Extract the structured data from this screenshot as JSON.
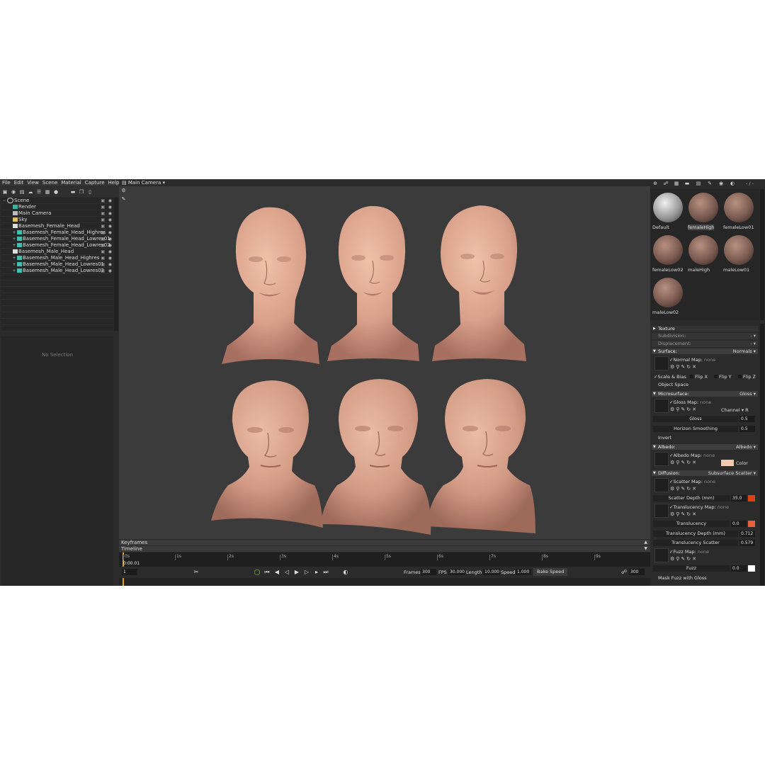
{
  "menu": [
    "File",
    "Edit",
    "View",
    "Scene",
    "Material",
    "Capture",
    "Help"
  ],
  "scene_toolbar_icons": [
    "cube-icon",
    "light-icon",
    "camera-icon",
    "sky-icon",
    "layers-icon",
    "box-icon",
    "sphere-icon",
    "folder-icon",
    "duplicate-icon",
    "trash-icon"
  ],
  "scene_tree": [
    {
      "label": "Scene",
      "indent": 0,
      "icon": "scene"
    },
    {
      "label": "Render",
      "indent": 1,
      "icon": "render"
    },
    {
      "label": "Main Camera",
      "indent": 1,
      "icon": "camera"
    },
    {
      "label": "Sky",
      "indent": 1,
      "icon": "sky"
    },
    {
      "label": "Basemesh_Female_Head",
      "indent": 1,
      "icon": "group"
    },
    {
      "label": "Basemesh_Female_Head_Highres",
      "indent": 2,
      "icon": "mesh"
    },
    {
      "label": "Basemesh_Female_Head_Lowres01",
      "indent": 2,
      "icon": "mesh"
    },
    {
      "label": "Basemesh_Female_Head_Lowres02",
      "indent": 2,
      "icon": "mesh"
    },
    {
      "label": "Basemesh_Male_Head",
      "indent": 1,
      "icon": "group"
    },
    {
      "label": "Basemesh_Male_Head_Highres",
      "indent": 2,
      "icon": "mesh"
    },
    {
      "label": "Basemesh_Male_Head_Lowres01",
      "indent": 2,
      "icon": "mesh"
    },
    {
      "label": "Basemesh_Male_Head_Lowres02",
      "indent": 2,
      "icon": "mesh"
    }
  ],
  "no_selection": "No Selection",
  "viewport": {
    "camera": "Main Camera"
  },
  "timeline": {
    "keyframes_label": "Keyframes",
    "timeline_label": "Timeline",
    "ticks": [
      "0s",
      "1s",
      "2s",
      "3s",
      "4s",
      "5s",
      "6s",
      "7s",
      "8s",
      "9s"
    ],
    "current_time": "0:00.01",
    "frame_field": "1",
    "frames_label": "Frames",
    "frames": "300",
    "fps_label": "FPS",
    "fps": "30.000",
    "length_label": "Length",
    "length": "10.000",
    "speed_label": "Speed",
    "speed": "1.000",
    "bake_label": "Bake Speed",
    "end_frame": "300"
  },
  "materials": {
    "toolbar_right": "- / -",
    "items": [
      {
        "name": "Default",
        "color": "#c8c8c8",
        "selected": false
      },
      {
        "name": "femaleHigh",
        "color": "#8a6a5e",
        "selected": true
      },
      {
        "name": "femaleLow01",
        "color": "#8c6c60",
        "selected": false
      },
      {
        "name": "femaleLow02",
        "color": "#8b6b5f",
        "selected": false
      },
      {
        "name": "maleHigh",
        "color": "#8a6a5e",
        "selected": false
      },
      {
        "name": "maleLow01",
        "color": "#8c6c60",
        "selected": false
      },
      {
        "name": "maleLow02",
        "color": "#8b6b5f",
        "selected": false
      }
    ]
  },
  "props": {
    "texture": "Texture",
    "subdivision": "Subdivision:",
    "displacement": "Displacement:",
    "surface": {
      "label": "Surface:",
      "mode": "Normals",
      "map_label": "Normal Map:",
      "map_value": "none",
      "scale_bias": "Scale & Bias",
      "flip_x": "Flip X",
      "flip_y": "Flip Y",
      "flip_z": "Flip Z",
      "object_space": "Object Space"
    },
    "microsurface": {
      "label": "Microsurface:",
      "mode": "Gloss",
      "map_label": "Gloss Map:",
      "map_value": "none",
      "channel": "Channel",
      "channel_value": "R",
      "gloss_label": "Gloss",
      "gloss": "0.5",
      "horizon_label": "Horizon Smoothing",
      "horizon": "0.5",
      "invert": "Invert"
    },
    "albedo": {
      "label": "Albedo:",
      "mode": "Albedo",
      "map_label": "Albedo Map:",
      "map_value": "none",
      "color_label": "Color",
      "color": "#f5c8b0"
    },
    "diffusion": {
      "label": "Diffusion:",
      "mode": "Subsurface Scatter",
      "scatter_map_label": "Scatter Map:",
      "scatter_map_value": "none",
      "scatter_depth_label": "Scatter Depth (mm)",
      "scatter_depth": "35.0",
      "scatter_color": "#e04010",
      "translucency_map_label": "Translucency Map:",
      "translucency_map_value": "none",
      "translucency_label": "Translucency",
      "translucency": "0.0",
      "translucency_color": "#e86040",
      "trans_depth_label": "Translucency Depth (mm)",
      "trans_depth": "0.712",
      "trans_scatter_label": "Translucency Scatter",
      "trans_scatter": "0.579",
      "fuzz_map_label": "Fuzz Map:",
      "fuzz_map_value": "none",
      "fuzz_label": "Fuzz",
      "fuzz": "0.0",
      "fuzz_color": "#ffffff",
      "mask_fuzz": "Mask Fuzz with Gloss"
    }
  },
  "colors": {
    "skin": "#d9a08a",
    "viewport_bg": "#3b3b3b",
    "accent": "#e0a020"
  }
}
